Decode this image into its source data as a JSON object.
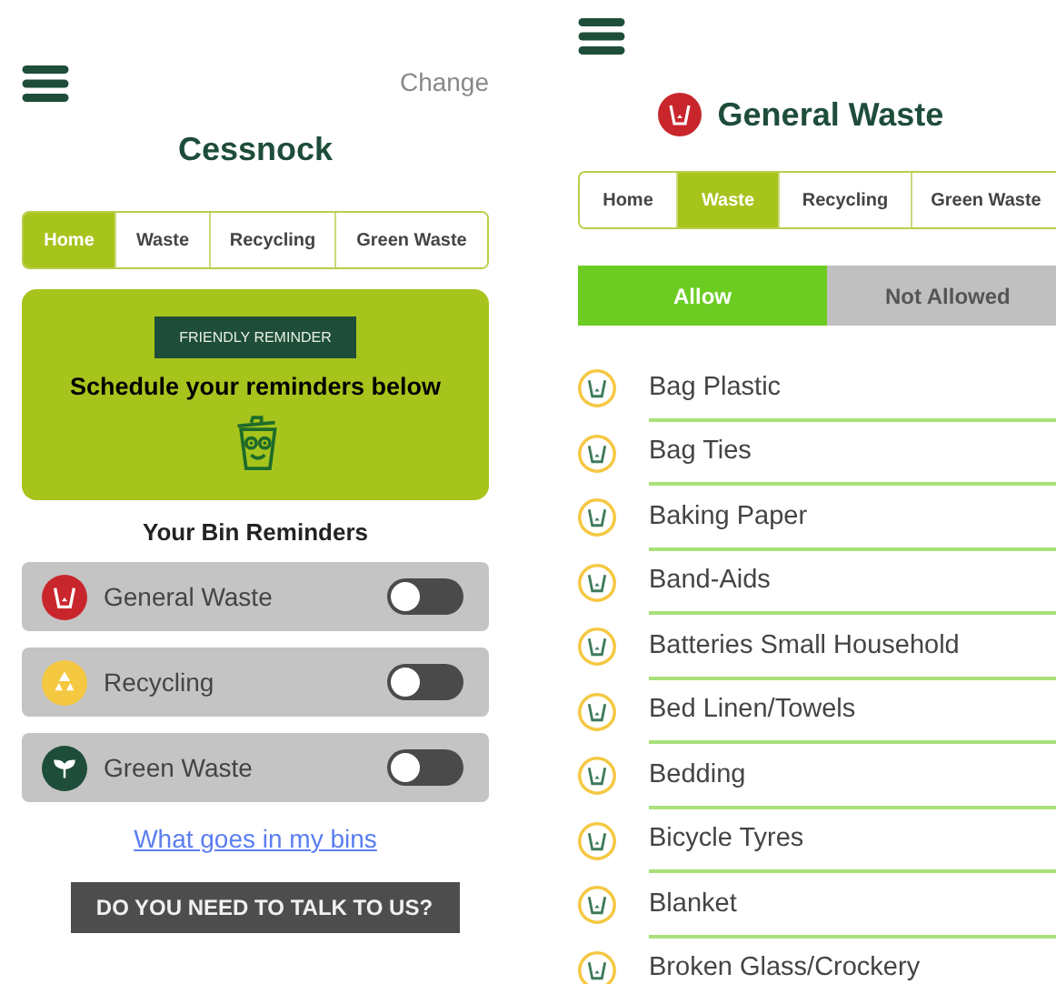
{
  "home_screen": {
    "change_link": "Change",
    "title": "Cessnock",
    "tabs": [
      {
        "label": "Home",
        "selected": true
      },
      {
        "label": "Waste",
        "selected": false
      },
      {
        "label": "Recycling",
        "selected": false
      },
      {
        "label": "Green Waste",
        "selected": false
      }
    ],
    "banner": {
      "badge": "FRIENDLY REMINDER",
      "heading": "Schedule your reminders below"
    },
    "reminders_heading": "Your Bin Reminders",
    "reminders": [
      {
        "kind": "general",
        "color": "#c8262c",
        "label": "General Waste",
        "on": false
      },
      {
        "kind": "recycling",
        "color": "#f5c842",
        "label": "Recycling",
        "on": false
      },
      {
        "kind": "green",
        "color": "#1e4d3a",
        "label": "Green Waste",
        "on": false
      }
    ],
    "bins_link": "What goes in my bins",
    "contact_button": "DO YOU NEED TO TALK TO US?"
  },
  "waste_screen": {
    "title": "General Waste",
    "tabs": [
      {
        "label": "Home",
        "selected": false
      },
      {
        "label": "Waste",
        "selected": true
      },
      {
        "label": "Recycling",
        "selected": false
      },
      {
        "label": "Green Waste",
        "selected": false
      }
    ],
    "filter": [
      {
        "label": "Allow",
        "selected": true
      },
      {
        "label": "Not Allowed",
        "selected": false
      }
    ],
    "items": [
      "Bag Plastic",
      "Bag Ties",
      "Baking Paper",
      "Band-Aids",
      "Batteries Small Household",
      "Bed Linen/Towels",
      "Bedding",
      "Bicycle Tyres",
      "Blanket",
      "Broken Glass/Crockery"
    ]
  }
}
